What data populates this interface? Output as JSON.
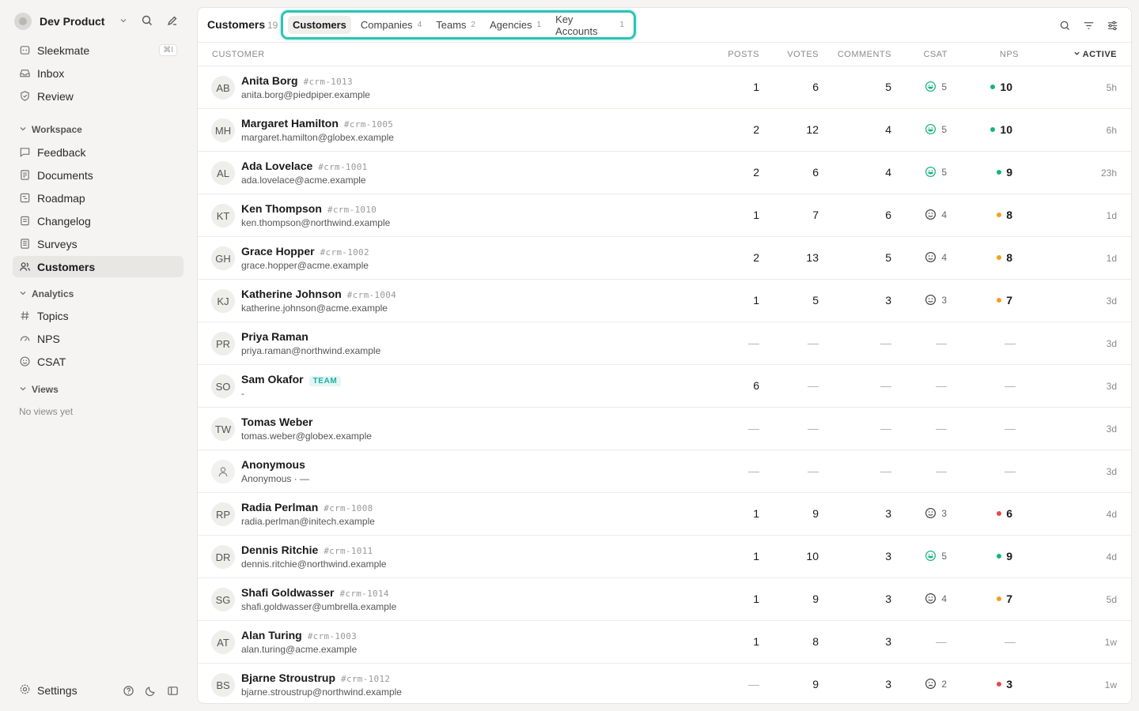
{
  "workspace": {
    "name": "Dev Product"
  },
  "nav_top": [
    {
      "label": "Sleekmate",
      "icon": "sparkle-icon",
      "shortcut": "⌘I"
    },
    {
      "label": "Inbox",
      "icon": "inbox-icon"
    },
    {
      "label": "Review",
      "icon": "shield-icon"
    }
  ],
  "sections": {
    "workspace": "Workspace",
    "analytics": "Analytics",
    "views": "Views"
  },
  "nav_workspace": [
    {
      "label": "Feedback",
      "icon": "chat-icon"
    },
    {
      "label": "Documents",
      "icon": "document-icon"
    },
    {
      "label": "Roadmap",
      "icon": "roadmap-icon"
    },
    {
      "label": "Changelog",
      "icon": "changelog-icon"
    },
    {
      "label": "Surveys",
      "icon": "survey-icon"
    },
    {
      "label": "Customers",
      "icon": "users-icon",
      "active": true
    }
  ],
  "nav_analytics": [
    {
      "label": "Topics",
      "icon": "hash-icon"
    },
    {
      "label": "NPS",
      "icon": "gauge-icon"
    },
    {
      "label": "CSAT",
      "icon": "smile-icon"
    }
  ],
  "views_empty": "No views yet",
  "settings_label": "Settings",
  "page": {
    "title": "Customers",
    "count": "19"
  },
  "tabs": [
    {
      "label": "Customers",
      "count": ""
    },
    {
      "label": "Companies",
      "count": "4"
    },
    {
      "label": "Teams",
      "count": "2"
    },
    {
      "label": "Agencies",
      "count": "1"
    },
    {
      "label": "Key Accounts",
      "count": "1"
    }
  ],
  "columns": {
    "customer": "CUSTOMER",
    "posts": "POSTS",
    "votes": "VOTES",
    "comments": "COMMENTS",
    "csat": "CSAT",
    "nps": "NPS",
    "active": "ACTIVE"
  },
  "colors": {
    "accent": "#2cc3b5",
    "nps_green": "#16b47e",
    "nps_orange": "#f5a01a",
    "nps_red": "#e5484d",
    "csat_happy": "#16b47e",
    "csat_neutral": "#444444"
  },
  "rows": [
    {
      "initials": "AB",
      "name": "Anita Borg",
      "tag": "#crm-1013",
      "email": "anita.borg@piedpiper.example",
      "posts": "1",
      "votes": "6",
      "comments": "5",
      "csat": "5",
      "csat_mood": "happy",
      "nps": "10",
      "nps_color": "green",
      "active": "5h"
    },
    {
      "initials": "MH",
      "name": "Margaret Hamilton",
      "tag": "#crm-1005",
      "email": "margaret.hamilton@globex.example",
      "posts": "2",
      "votes": "12",
      "comments": "4",
      "csat": "5",
      "csat_mood": "happy",
      "nps": "10",
      "nps_color": "green",
      "active": "6h"
    },
    {
      "initials": "AL",
      "name": "Ada Lovelace",
      "tag": "#crm-1001",
      "email": "ada.lovelace@acme.example",
      "posts": "2",
      "votes": "6",
      "comments": "4",
      "csat": "5",
      "csat_mood": "happy",
      "nps": "9",
      "nps_color": "green",
      "active": "23h"
    },
    {
      "initials": "KT",
      "name": "Ken Thompson",
      "tag": "#crm-1010",
      "email": "ken.thompson@northwind.example",
      "posts": "1",
      "votes": "7",
      "comments": "6",
      "csat": "4",
      "csat_mood": "neutral",
      "nps": "8",
      "nps_color": "orange",
      "active": "1d"
    },
    {
      "initials": "GH",
      "name": "Grace Hopper",
      "tag": "#crm-1002",
      "email": "grace.hopper@acme.example",
      "posts": "2",
      "votes": "13",
      "comments": "5",
      "csat": "4",
      "csat_mood": "neutral",
      "nps": "8",
      "nps_color": "orange",
      "active": "1d"
    },
    {
      "initials": "KJ",
      "name": "Katherine Johnson",
      "tag": "#crm-1004",
      "email": "katherine.johnson@acme.example",
      "posts": "1",
      "votes": "5",
      "comments": "3",
      "csat": "3",
      "csat_mood": "neutral",
      "nps": "7",
      "nps_color": "orange",
      "active": "3d"
    },
    {
      "initials": "PR",
      "name": "Priya Raman",
      "tag": "",
      "email": "priya.raman@northwind.example",
      "posts": "—",
      "votes": "—",
      "comments": "—",
      "csat": "—",
      "csat_mood": "",
      "nps": "—",
      "nps_color": "",
      "active": "3d"
    },
    {
      "initials": "SO",
      "name": "Sam Okafor",
      "tag": "",
      "badge": "TEAM",
      "email": "-",
      "posts": "6",
      "votes": "—",
      "comments": "—",
      "csat": "—",
      "csat_mood": "",
      "nps": "—",
      "nps_color": "",
      "active": "3d"
    },
    {
      "initials": "TW",
      "name": "Tomas Weber",
      "tag": "",
      "email": "tomas.weber@globex.example",
      "posts": "—",
      "votes": "—",
      "comments": "—",
      "csat": "—",
      "csat_mood": "",
      "nps": "—",
      "nps_color": "",
      "active": "3d"
    },
    {
      "initials": "",
      "anon": true,
      "name": "Anonymous",
      "tag": "",
      "email": "Anonymous · —",
      "posts": "—",
      "votes": "—",
      "comments": "—",
      "csat": "—",
      "csat_mood": "",
      "nps": "—",
      "nps_color": "",
      "active": "3d"
    },
    {
      "initials": "RP",
      "name": "Radia Perlman",
      "tag": "#crm-1008",
      "email": "radia.perlman@initech.example",
      "posts": "1",
      "votes": "9",
      "comments": "3",
      "csat": "3",
      "csat_mood": "neutral",
      "nps": "6",
      "nps_color": "red",
      "active": "4d"
    },
    {
      "initials": "DR",
      "name": "Dennis Ritchie",
      "tag": "#crm-1011",
      "email": "dennis.ritchie@northwind.example",
      "posts": "1",
      "votes": "10",
      "comments": "3",
      "csat": "5",
      "csat_mood": "happy",
      "nps": "9",
      "nps_color": "green",
      "active": "4d"
    },
    {
      "initials": "SG",
      "name": "Shafi Goldwasser",
      "tag": "#crm-1014",
      "email": "shafi.goldwasser@umbrella.example",
      "posts": "1",
      "votes": "9",
      "comments": "3",
      "csat": "4",
      "csat_mood": "neutral",
      "nps": "7",
      "nps_color": "orange",
      "active": "5d"
    },
    {
      "initials": "AT",
      "name": "Alan Turing",
      "tag": "#crm-1003",
      "email": "alan.turing@acme.example",
      "posts": "1",
      "votes": "8",
      "comments": "3",
      "csat": "—",
      "csat_mood": "",
      "nps": "—",
      "nps_color": "",
      "active": "1w"
    },
    {
      "initials": "BS",
      "name": "Bjarne Stroustrup",
      "tag": "#crm-1012",
      "email": "bjarne.stroustrup@northwind.example",
      "posts": "—",
      "votes": "9",
      "comments": "3",
      "csat": "2",
      "csat_mood": "sad",
      "nps": "3",
      "nps_color": "red",
      "active": "1w"
    }
  ]
}
